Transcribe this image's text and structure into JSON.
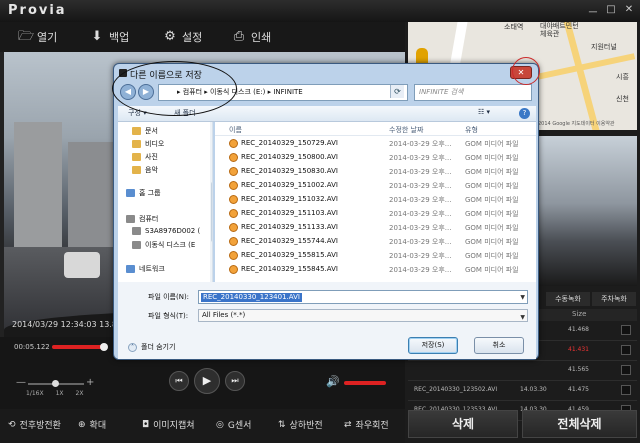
{
  "app": {
    "logo": "Provia",
    "window_buttons": [
      "ㅡ",
      "□",
      "✕"
    ]
  },
  "toolbar": {
    "open": "열기",
    "backup": "백업",
    "settings": "설정",
    "print": "인쇄"
  },
  "video": {
    "timestamp": "2014/03/29 12:34:03  13.8V  0.0°C"
  },
  "player": {
    "time": "00:05.122",
    "zoom_labels": [
      "1/16X",
      "1X",
      "2X"
    ],
    "controls": {
      "prev": "⏮",
      "play": "▶",
      "next": "⏭"
    }
  },
  "bottombar": {
    "front_rear": "전후방전환",
    "zoom": "확대",
    "image_capture": "이미지캡쳐",
    "g_sensor": "G센서",
    "flip_vertical": "상하반전",
    "flip_horizontal": "좌우회전"
  },
  "map": {
    "labels": [
      "소태역",
      "대야배트민턴 체육관",
      "지원터널",
      "시흥",
      "신천"
    ],
    "footer": "©2014 Google 지도데이터 이용약관"
  },
  "right_panel": {
    "tabs": [
      "수동녹화",
      "주차녹화"
    ],
    "list_header": {
      "size": "Size"
    },
    "rows": [
      {
        "name": "",
        "time": "",
        "size": "41.468",
        "red": false
      },
      {
        "name": "",
        "time": "",
        "size": "41.431",
        "red": true
      },
      {
        "name": "",
        "time": "",
        "size": "41.565",
        "red": false
      },
      {
        "name": "REC_20140330_123502.AVI",
        "time": "14.03.30",
        "size": "41.475",
        "red": false
      },
      {
        "name": "REC_20140330_123533.AVI",
        "time": "14.03.30",
        "size": "41.459",
        "red": false
      }
    ],
    "delete": "삭제",
    "delete_all": "전체삭제"
  },
  "dialog": {
    "title": "다른 이름으로 저장",
    "address": "▸ 컴퓨터 ▸ 이동식 디스크 (E:) ▸ INFINITE",
    "search_placeholder": "INFINITE 검색",
    "command_organize": "구성 ▾",
    "command_new_folder": "새 폴더",
    "nav_items": [
      {
        "label": "문서",
        "icon": "folder"
      },
      {
        "label": "비디오",
        "icon": "folder"
      },
      {
        "label": "사진",
        "icon": "folder"
      },
      {
        "label": "음악",
        "icon": "folder"
      },
      {
        "label": "홈 그룹",
        "icon": "homegroup"
      },
      {
        "label": "컴퓨터",
        "icon": "computer"
      },
      {
        "label": "S3A8976D002 (",
        "icon": "drive"
      },
      {
        "label": "이동식 디스크 (E",
        "icon": "drive"
      },
      {
        "label": "네트워크",
        "icon": "network"
      }
    ],
    "columns": [
      "이름",
      "수정한 날짜",
      "유형"
    ],
    "files": [
      {
        "name": "REC_20140329_150729.AVI",
        "date": "2014-03-29 오후...",
        "type": "GOM 미디어 파일"
      },
      {
        "name": "REC_20140329_150800.AVI",
        "date": "2014-03-29 오후...",
        "type": "GOM 미디어 파일"
      },
      {
        "name": "REC_20140329_150830.AVI",
        "date": "2014-03-29 오후...",
        "type": "GOM 미디어 파일"
      },
      {
        "name": "REC_20140329_151002.AVI",
        "date": "2014-03-29 오후...",
        "type": "GOM 미디어 파일"
      },
      {
        "name": "REC_20140329_151032.AVI",
        "date": "2014-03-29 오후...",
        "type": "GOM 미디어 파일"
      },
      {
        "name": "REC_20140329_151103.AVI",
        "date": "2014-03-29 오후...",
        "type": "GOM 미디어 파일"
      },
      {
        "name": "REC_20140329_151133.AVI",
        "date": "2014-03-29 오후...",
        "type": "GOM 미디어 파일"
      },
      {
        "name": "REC_20140329_155744.AVI",
        "date": "2014-03-29 오후...",
        "type": "GOM 미디어 파일"
      },
      {
        "name": "REC_20140329_155815.AVI",
        "date": "2014-03-29 오후...",
        "type": "GOM 미디어 파일"
      },
      {
        "name": "REC_20140329_155845.AVI",
        "date": "2014-03-29 오후...",
        "type": "GOM 미디어 파일"
      }
    ],
    "filename_label": "파일 이름(N):",
    "filename_value": "REC_20140330_123401.AVI",
    "filetype_label": "파일 형식(T):",
    "filetype_value": "All Files (*.*)",
    "hide_folders": "폴더 숨기기",
    "save": "저장(S)",
    "cancel": "취소"
  }
}
